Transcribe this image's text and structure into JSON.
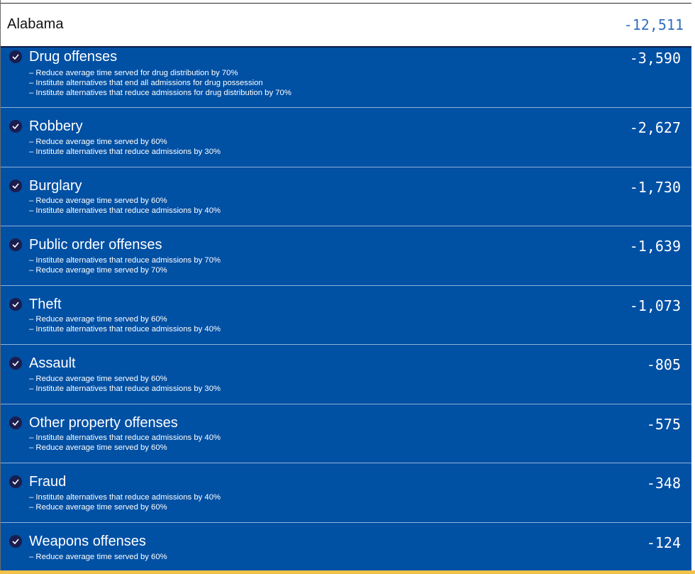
{
  "header": {
    "state": "Alabama",
    "total": "-12,511"
  },
  "offenses": [
    {
      "title": "Drug offenses",
      "value": "-3,590",
      "details": [
        "– Reduce average time served for drug distribution by 70%",
        "– Institute alternatives that end all admissions for drug possession",
        "– Institute alternatives that reduce admissions for drug distribution by 70%"
      ]
    },
    {
      "title": "Robbery",
      "value": "-2,627",
      "details": [
        "– Reduce average time served by 60%",
        "– Institute alternatives that reduce admissions by 30%"
      ]
    },
    {
      "title": "Burglary",
      "value": "-1,730",
      "details": [
        "– Reduce average time served by 60%",
        "– Institute alternatives that reduce admissions by 40%"
      ]
    },
    {
      "title": "Public order offenses",
      "value": "-1,639",
      "details": [
        "– Institute alternatives that reduce admissions by 70%",
        "– Reduce average time served by 70%"
      ]
    },
    {
      "title": "Theft",
      "value": "-1,073",
      "details": [
        "– Reduce average time served by 60%",
        "– Institute alternatives that reduce admissions by 40%"
      ]
    },
    {
      "title": "Assault",
      "value": "-805",
      "details": [
        "– Reduce average time served by 60%",
        "– Institute alternatives that reduce admissions by 30%"
      ]
    },
    {
      "title": "Other property offenses",
      "value": "-575",
      "details": [
        "– Institute alternatives that reduce admissions by 40%",
        "– Reduce average time served by 60%"
      ]
    },
    {
      "title": "Fraud",
      "value": "-348",
      "details": [
        "– Institute alternatives that reduce admissions by 40%",
        "– Reduce average time served by 60%"
      ]
    },
    {
      "title": "Weapons offenses",
      "value": "-124",
      "details": [
        "– Reduce average time served by 60%"
      ]
    }
  ],
  "colors": {
    "list_background": "#0050a4",
    "total_text": "#2f6fbf",
    "check_circle": "#1b1d4f",
    "footer_accent": "#f2c14a"
  },
  "icons": {
    "row_marker": "checkmark-circle-icon"
  }
}
